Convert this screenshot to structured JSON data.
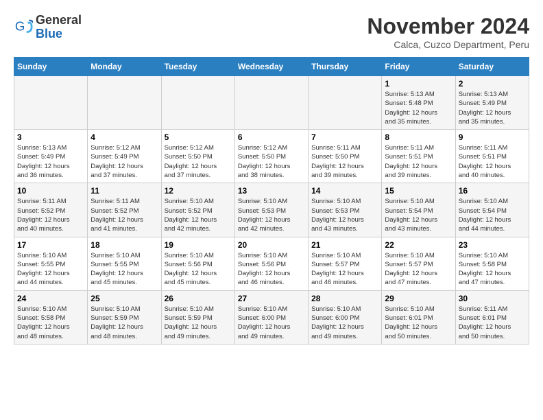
{
  "header": {
    "logo_general": "General",
    "logo_blue": "Blue",
    "month_title": "November 2024",
    "subtitle": "Calca, Cuzco Department, Peru"
  },
  "days_of_week": [
    "Sunday",
    "Monday",
    "Tuesday",
    "Wednesday",
    "Thursday",
    "Friday",
    "Saturday"
  ],
  "weeks": [
    [
      {
        "num": "",
        "info": ""
      },
      {
        "num": "",
        "info": ""
      },
      {
        "num": "",
        "info": ""
      },
      {
        "num": "",
        "info": ""
      },
      {
        "num": "",
        "info": ""
      },
      {
        "num": "1",
        "info": "Sunrise: 5:13 AM\nSunset: 5:48 PM\nDaylight: 12 hours\nand 35 minutes."
      },
      {
        "num": "2",
        "info": "Sunrise: 5:13 AM\nSunset: 5:49 PM\nDaylight: 12 hours\nand 35 minutes."
      }
    ],
    [
      {
        "num": "3",
        "info": "Sunrise: 5:13 AM\nSunset: 5:49 PM\nDaylight: 12 hours\nand 36 minutes."
      },
      {
        "num": "4",
        "info": "Sunrise: 5:12 AM\nSunset: 5:49 PM\nDaylight: 12 hours\nand 37 minutes."
      },
      {
        "num": "5",
        "info": "Sunrise: 5:12 AM\nSunset: 5:50 PM\nDaylight: 12 hours\nand 37 minutes."
      },
      {
        "num": "6",
        "info": "Sunrise: 5:12 AM\nSunset: 5:50 PM\nDaylight: 12 hours\nand 38 minutes."
      },
      {
        "num": "7",
        "info": "Sunrise: 5:11 AM\nSunset: 5:50 PM\nDaylight: 12 hours\nand 39 minutes."
      },
      {
        "num": "8",
        "info": "Sunrise: 5:11 AM\nSunset: 5:51 PM\nDaylight: 12 hours\nand 39 minutes."
      },
      {
        "num": "9",
        "info": "Sunrise: 5:11 AM\nSunset: 5:51 PM\nDaylight: 12 hours\nand 40 minutes."
      }
    ],
    [
      {
        "num": "10",
        "info": "Sunrise: 5:11 AM\nSunset: 5:52 PM\nDaylight: 12 hours\nand 40 minutes."
      },
      {
        "num": "11",
        "info": "Sunrise: 5:11 AM\nSunset: 5:52 PM\nDaylight: 12 hours\nand 41 minutes."
      },
      {
        "num": "12",
        "info": "Sunrise: 5:10 AM\nSunset: 5:52 PM\nDaylight: 12 hours\nand 42 minutes."
      },
      {
        "num": "13",
        "info": "Sunrise: 5:10 AM\nSunset: 5:53 PM\nDaylight: 12 hours\nand 42 minutes."
      },
      {
        "num": "14",
        "info": "Sunrise: 5:10 AM\nSunset: 5:53 PM\nDaylight: 12 hours\nand 43 minutes."
      },
      {
        "num": "15",
        "info": "Sunrise: 5:10 AM\nSunset: 5:54 PM\nDaylight: 12 hours\nand 43 minutes."
      },
      {
        "num": "16",
        "info": "Sunrise: 5:10 AM\nSunset: 5:54 PM\nDaylight: 12 hours\nand 44 minutes."
      }
    ],
    [
      {
        "num": "17",
        "info": "Sunrise: 5:10 AM\nSunset: 5:55 PM\nDaylight: 12 hours\nand 44 minutes."
      },
      {
        "num": "18",
        "info": "Sunrise: 5:10 AM\nSunset: 5:55 PM\nDaylight: 12 hours\nand 45 minutes."
      },
      {
        "num": "19",
        "info": "Sunrise: 5:10 AM\nSunset: 5:56 PM\nDaylight: 12 hours\nand 45 minutes."
      },
      {
        "num": "20",
        "info": "Sunrise: 5:10 AM\nSunset: 5:56 PM\nDaylight: 12 hours\nand 46 minutes."
      },
      {
        "num": "21",
        "info": "Sunrise: 5:10 AM\nSunset: 5:57 PM\nDaylight: 12 hours\nand 46 minutes."
      },
      {
        "num": "22",
        "info": "Sunrise: 5:10 AM\nSunset: 5:57 PM\nDaylight: 12 hours\nand 47 minutes."
      },
      {
        "num": "23",
        "info": "Sunrise: 5:10 AM\nSunset: 5:58 PM\nDaylight: 12 hours\nand 47 minutes."
      }
    ],
    [
      {
        "num": "24",
        "info": "Sunrise: 5:10 AM\nSunset: 5:58 PM\nDaylight: 12 hours\nand 48 minutes."
      },
      {
        "num": "25",
        "info": "Sunrise: 5:10 AM\nSunset: 5:59 PM\nDaylight: 12 hours\nand 48 minutes."
      },
      {
        "num": "26",
        "info": "Sunrise: 5:10 AM\nSunset: 5:59 PM\nDaylight: 12 hours\nand 49 minutes."
      },
      {
        "num": "27",
        "info": "Sunrise: 5:10 AM\nSunset: 6:00 PM\nDaylight: 12 hours\nand 49 minutes."
      },
      {
        "num": "28",
        "info": "Sunrise: 5:10 AM\nSunset: 6:00 PM\nDaylight: 12 hours\nand 49 minutes."
      },
      {
        "num": "29",
        "info": "Sunrise: 5:10 AM\nSunset: 6:01 PM\nDaylight: 12 hours\nand 50 minutes."
      },
      {
        "num": "30",
        "info": "Sunrise: 5:11 AM\nSunset: 6:01 PM\nDaylight: 12 hours\nand 50 minutes."
      }
    ]
  ]
}
